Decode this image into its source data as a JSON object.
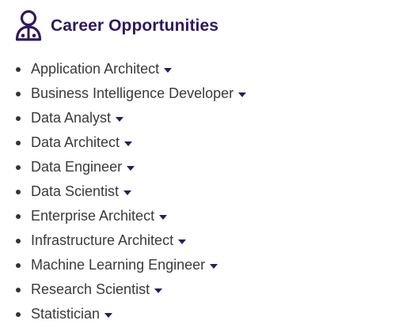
{
  "header": {
    "icon": "person-icon",
    "title": "Career Opportunities"
  },
  "careers": {
    "items": [
      {
        "label": "Application Architect",
        "icon": "caret-down-icon"
      },
      {
        "label": "Business Intelligence Developer",
        "icon": "caret-down-icon"
      },
      {
        "label": "Data Analyst",
        "icon": "caret-down-icon"
      },
      {
        "label": "Data Architect",
        "icon": "caret-down-icon"
      },
      {
        "label": "Data Engineer",
        "icon": "caret-down-icon"
      },
      {
        "label": "Data Scientist",
        "icon": "caret-down-icon"
      },
      {
        "label": "Enterprise Architect",
        "icon": "caret-down-icon"
      },
      {
        "label": "Infrastructure Architect",
        "icon": "caret-down-icon"
      },
      {
        "label": "Machine Learning Engineer",
        "icon": "caret-down-icon"
      },
      {
        "label": "Research Scientist",
        "icon": "caret-down-icon"
      },
      {
        "label": "Statistician",
        "icon": "caret-down-icon"
      }
    ]
  },
  "colors": {
    "accent": "#2e1a5e",
    "text": "#3a3a3a",
    "bullet": "#333333"
  }
}
